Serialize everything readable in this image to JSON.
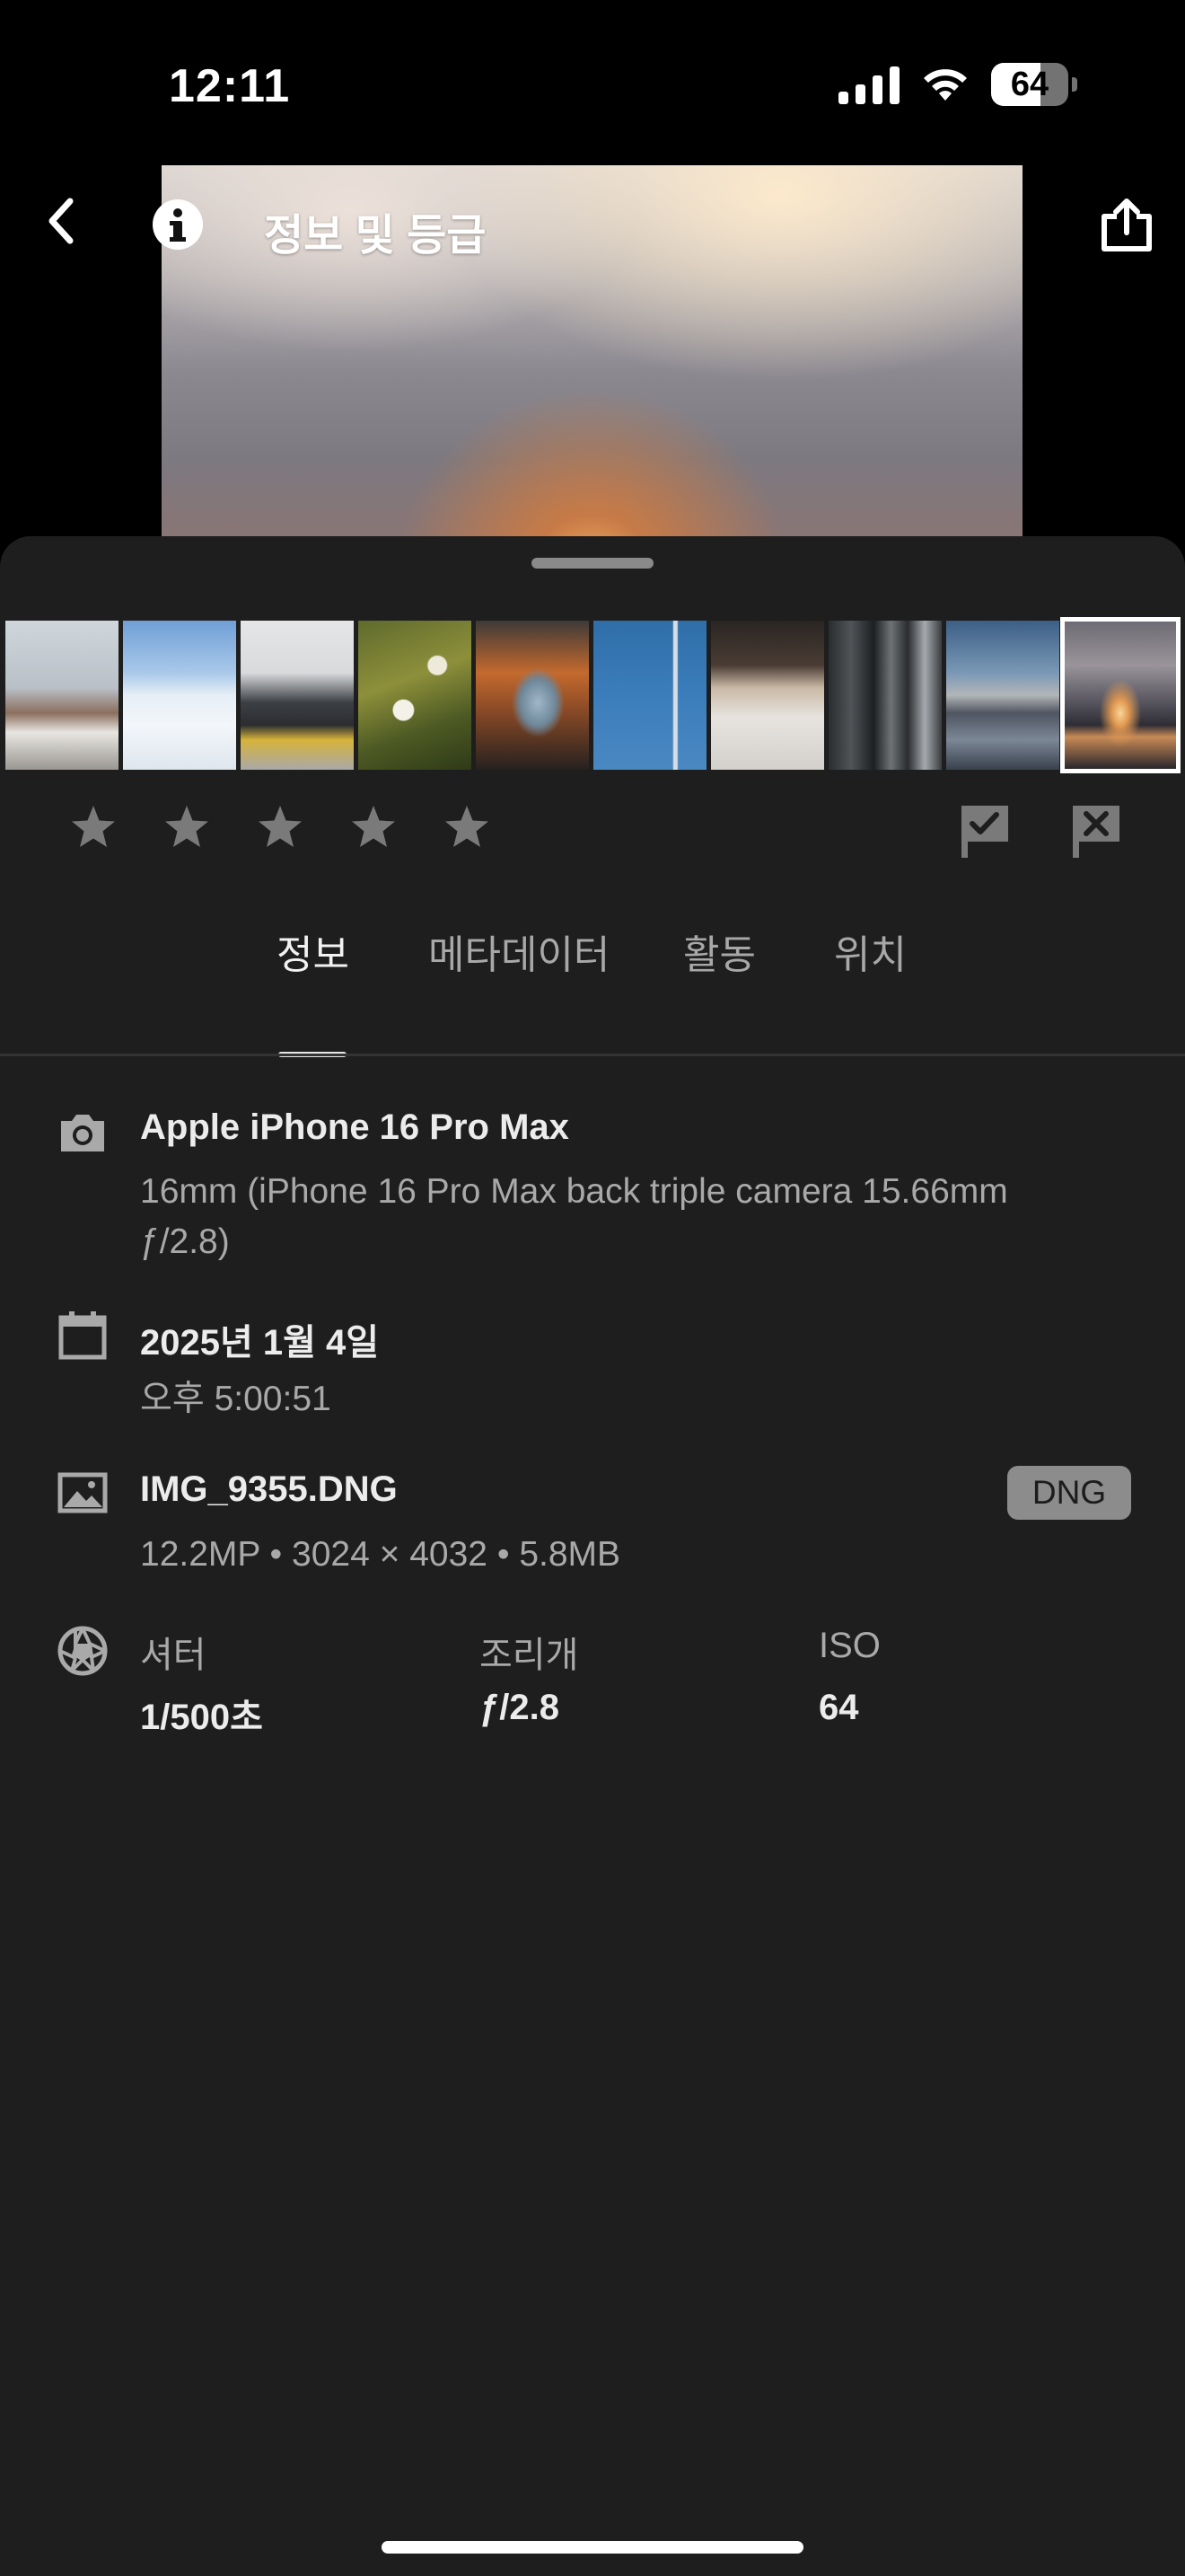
{
  "status_bar": {
    "time": "12:11",
    "battery": "64",
    "battery_level_percent": 64
  },
  "header": {
    "title": "정보 및 등급",
    "back_icon": "chevron-left-icon",
    "info_icon": "info-icon",
    "share_icon": "share-icon"
  },
  "filmstrip": {
    "selected_index": 9,
    "thumbnails": [
      {
        "subject": "winter house with bare tree"
      },
      {
        "subject": "snowy field and blue sky"
      },
      {
        "subject": "modern building with yellow car"
      },
      {
        "subject": "green plant with snow"
      },
      {
        "subject": "car side mirror at sunset"
      },
      {
        "subject": "street lamp against blue sky"
      },
      {
        "subject": "snowy path with temple gate"
      },
      {
        "subject": "glass storefront doors"
      },
      {
        "subject": "lake at dusk"
      },
      {
        "subject": "sunset over water"
      }
    ]
  },
  "rating": {
    "stars": 5,
    "filled": 0,
    "pick_icon": "pick-flag-icon",
    "reject_icon": "reject-flag-icon"
  },
  "tabs": [
    {
      "label": "정보",
      "active": true
    },
    {
      "label": "메타데이터",
      "active": false
    },
    {
      "label": "활동",
      "active": false
    },
    {
      "label": "위치",
      "active": false
    }
  ],
  "info": {
    "camera": {
      "icon": "camera-icon",
      "model": "Apple iPhone 16 Pro Max",
      "lens_line1": "16mm (iPhone 16 Pro Max back triple camera 15.66mm",
      "lens_line2": "ƒ/2.8)"
    },
    "date": {
      "icon": "calendar-icon",
      "date": "2025년 1월 4일",
      "time": "오후 5:00:51"
    },
    "file": {
      "icon": "image-icon",
      "name": "IMG_9355.DNG",
      "details": "12.2MP • 3024 × 4032 • 5.8MB",
      "badge": "DNG"
    },
    "exposure": {
      "icon": "aperture-icon",
      "shutter_label": "셔터",
      "shutter_value": "1/500초",
      "aperture_label": "조리개",
      "aperture_value": "ƒ/2.8",
      "iso_label": "ISO",
      "iso_value": "64"
    }
  },
  "colors": {
    "background": "#000000",
    "sheet": "#1e1e1e",
    "text_primary": "#ececec",
    "text_secondary": "#a9a9a9",
    "badge": "#8c8c8c"
  }
}
